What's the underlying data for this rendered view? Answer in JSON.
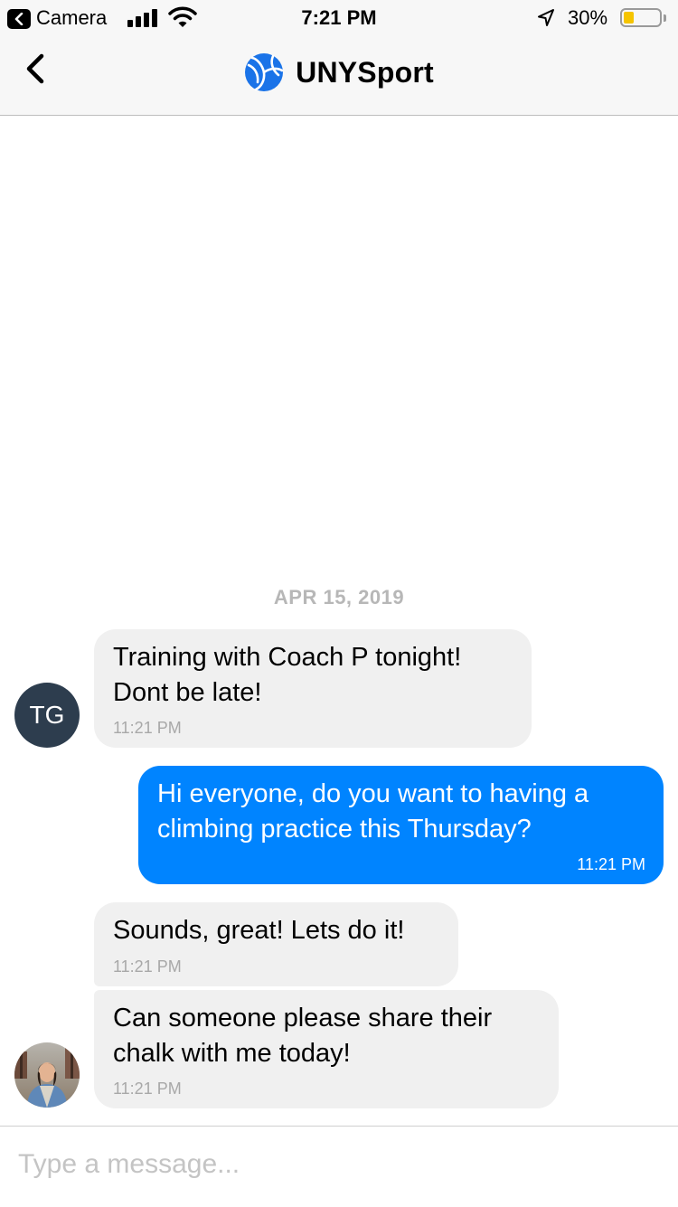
{
  "status_bar": {
    "back_app": "Camera",
    "time": "7:21 PM",
    "battery_percent": "30%",
    "battery_level": 0.3,
    "icons": [
      "back-arrow-icon",
      "cellular-signal-icon",
      "wifi-icon",
      "location-arrow-icon",
      "battery-icon"
    ]
  },
  "header": {
    "title": "UNYSport",
    "back_icon": "chevron-left-icon",
    "logo_icon": "volleyball-logo-icon"
  },
  "chat": {
    "date_separator": "APR 15, 2019",
    "messages": [
      {
        "sender": "TG",
        "direction": "incoming",
        "text": "Training with Coach P tonight!\nDont be late!",
        "time": "11:21 PM"
      },
      {
        "sender": "me",
        "direction": "outgoing",
        "text": "Hi everyone, do you want to having a\nclimbing practice this Thursday?",
        "time": "11:21 PM"
      },
      {
        "sender": "photo-user",
        "direction": "incoming",
        "text": "Sounds, great! Lets do it!",
        "time": "11:21 PM"
      },
      {
        "sender": "photo-user",
        "direction": "incoming",
        "text": "Can someone please share their\nchalk with me today!",
        "time": "11:21 PM"
      }
    ],
    "avatars": {
      "tg_initials": "TG"
    }
  },
  "composer": {
    "placeholder": "Type a message...",
    "value": ""
  },
  "colors": {
    "outgoing_bubble": "#0084ff",
    "incoming_bubble": "#f0f0f0",
    "avatar_tg_bg": "#2d3d4e",
    "logo_blue": "#1a73e8",
    "battery_fill": "#f5c400"
  }
}
